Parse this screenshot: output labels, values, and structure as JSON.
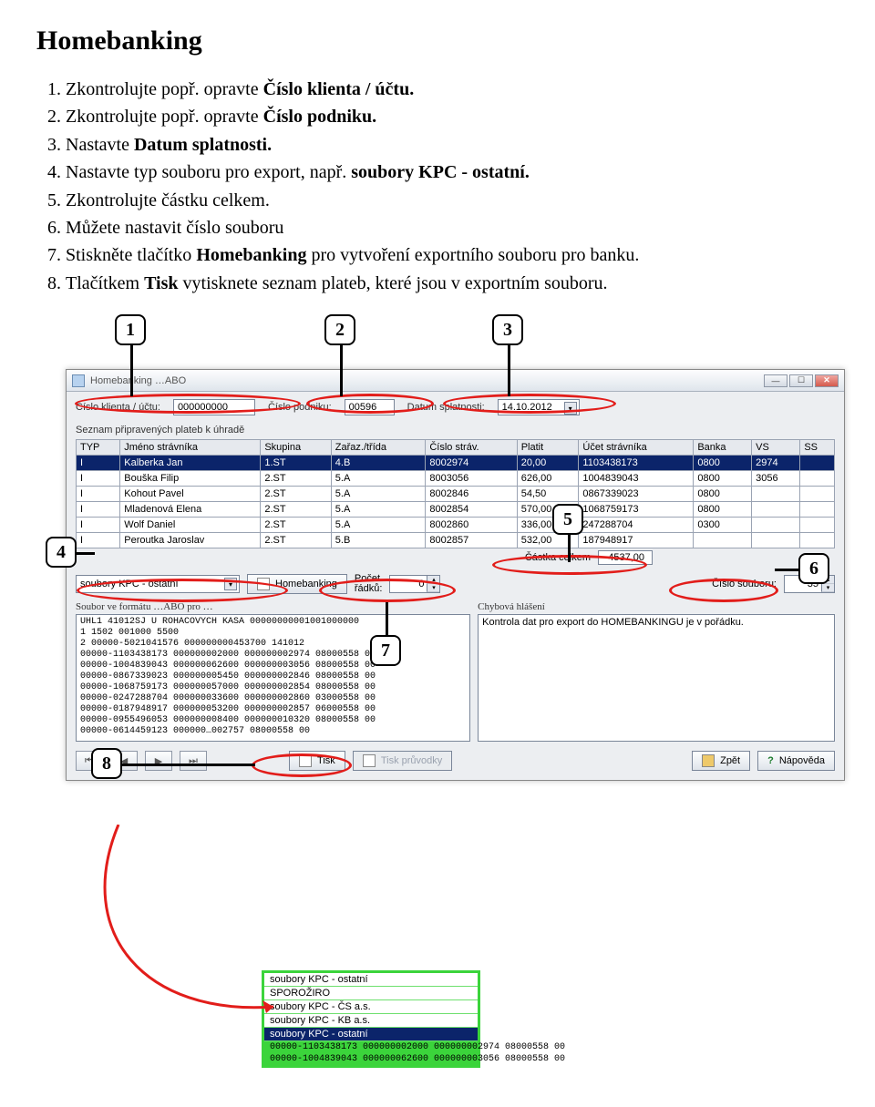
{
  "page": {
    "heading": "Homebanking",
    "steps": [
      {
        "pre": "Zkontrolujte popř. opravte ",
        "bold": "Číslo klienta / účtu.",
        "post": ""
      },
      {
        "pre": "Zkontrolujte popř. opravte ",
        "bold": "Číslo podniku.",
        "post": ""
      },
      {
        "pre": "Nastavte ",
        "bold": "Datum splatnosti.",
        "post": ""
      },
      {
        "pre": "Nastavte typ souboru pro export, např. ",
        "bold": "soubory KPC - ostatní.",
        "post": ""
      },
      {
        "pre": "Zkontrolujte částku celkem.",
        "bold": "",
        "post": ""
      },
      {
        "pre": "Můžete nastavit číslo souboru",
        "bold": "",
        "post": ""
      },
      {
        "pre": "Stiskněte tlačítko ",
        "bold": "Homebanking",
        "post": " pro vytvoření exportního souboru pro banku."
      },
      {
        "pre": "Tlačítkem ",
        "bold": "Tisk",
        "post": " vytisknete seznam plateb, které jsou v exportním souboru."
      }
    ]
  },
  "window": {
    "title": "Homebanking …ABO",
    "fields": {
      "client_label": "Číslo klienta / účtu:",
      "client_value": "000000000",
      "company_label": "Číslo podniku:",
      "company_value": "00596",
      "due_label": "Datum splatnosti:",
      "due_value": "14.10.2012"
    },
    "section_title": "Seznam připravených plateb k úhradě",
    "columns": [
      "TYP",
      "Jméno strávníka",
      "Skupina",
      "Zařaz./třída",
      "Číslo stráv.",
      "Platit",
      "Účet strávníka",
      "Banka",
      "VS",
      "SS"
    ],
    "rows": [
      [
        "I",
        "Kalberka Jan",
        "1.ST",
        "4.B",
        "8002974",
        "20,00",
        "1103438173",
        "0800",
        "2974",
        ""
      ],
      [
        "I",
        "Bouška Filip",
        "2.ST",
        "5.A",
        "8003056",
        "626,00",
        "1004839043",
        "0800",
        "3056",
        ""
      ],
      [
        "I",
        "Kohout Pavel",
        "2.ST",
        "5.A",
        "8002846",
        "54,50",
        "0867339023",
        "0800",
        "",
        ""
      ],
      [
        "I",
        "Mladenová Elena",
        "2.ST",
        "5.A",
        "8002854",
        "570,00",
        "1068759173",
        "0800",
        "",
        ""
      ],
      [
        "I",
        "Wolf Daniel",
        "2.ST",
        "5.A",
        "8002860",
        "336,00",
        "247288704",
        "0300",
        "",
        ""
      ],
      [
        "I",
        "Peroutka Jaroslav",
        "2.ST",
        "5.B",
        "8002857",
        "532,00",
        "187948917",
        "",
        "",
        ""
      ]
    ],
    "total_label": "Částka celkem",
    "total_value": "4537,00",
    "export_type": "soubory KPC - ostatní",
    "hb_button": "Homebanking",
    "rows_label": "Počet\nřádků:",
    "rows_value": "0",
    "fileno_label": "Číslo souboru:",
    "fileno_value": "35",
    "left_title": "Soubor ve formátu …ABO pro …",
    "left_text": "UHL1 41012SJ U ROHACOVYCH KASA 00000000001001000000\n1 1502 001000 5500\n2 00000-5021041576 000000000453700 141012\n00000-1103438173 000000002000 000000002974 08000558 00\n00000-1004839043 000000062600 000000003056 08000558 00\n00000-0867339023 000000005450 000000002846 08000558 00\n00000-1068759173 000000057000 000000002854 08000558 00\n00000-0247288704 000000033600 000000002860 03000558 00\n00000-0187948917 000000053200 000000002857 06000558 00\n00000-0955496053 000000008400 000000010320 08000558 00\n00000-0614459123 000000…002757 08000558 00",
    "right_title": "Chybová hlášení",
    "right_text": "Kontrola dat pro export do HOMEBANKINGU je v pořádku.",
    "btn_tisk": "Tisk",
    "btn_tiskp": "Tisk průvodky",
    "btn_zpet": "Zpět",
    "btn_help": "Nápověda"
  },
  "popup": {
    "options": [
      "soubory KPC - ostatní",
      "SPOROŽIRO",
      "soubory KPC - ČS a.s.",
      "soubory KPC - KB a.s.",
      "soubory KPC - ostatní"
    ],
    "selected_index": 4,
    "tail1": "00000-1103438173 000000002000 000000002974 08000558 00",
    "tail2": "00000-1004839043 000000062600 000000003056 08000558 00"
  },
  "callouts": [
    "1",
    "2",
    "3",
    "4",
    "5",
    "6",
    "7",
    "8"
  ]
}
